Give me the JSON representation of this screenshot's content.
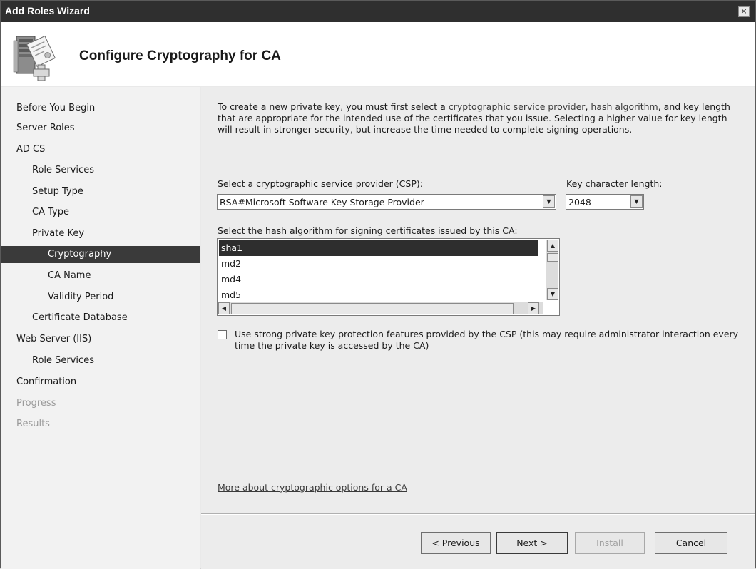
{
  "window": {
    "title": "Add Roles Wizard",
    "close_glyph": "×"
  },
  "header": {
    "title": "Configure Cryptography for CA",
    "icon": "server-certificate-icon"
  },
  "sidebar": {
    "items": [
      {
        "label": "Before You Begin"
      },
      {
        "label": "Server Roles"
      },
      {
        "label": "AD CS"
      },
      {
        "label": "Role Services"
      },
      {
        "label": "Setup Type"
      },
      {
        "label": "CA Type"
      },
      {
        "label": "Private Key"
      },
      {
        "label": "Cryptography"
      },
      {
        "label": "CA Name"
      },
      {
        "label": "Validity Period"
      },
      {
        "label": "Certificate Database"
      },
      {
        "label": "Web Server (IIS)"
      },
      {
        "label": "Role Services"
      },
      {
        "label": "Confirmation"
      },
      {
        "label": "Progress"
      },
      {
        "label": "Results"
      }
    ]
  },
  "description": {
    "part1": "To create a new private key, you must first select a ",
    "link1": "cryptographic service provider",
    "part2": ", ",
    "link2": "hash algorithm",
    "part3": ", and key length that are appropriate for the intended use of the certificates that you issue. Selecting a higher value for key length will result in stronger security, but increase the time needed to complete signing operations."
  },
  "csp": {
    "label": "Select a cryptographic service provider (CSP):",
    "value": "RSA#Microsoft Software Key Storage Provider"
  },
  "key_length": {
    "label": "Key character length:",
    "value": "2048"
  },
  "hash": {
    "label": "Select the hash algorithm for signing certificates issued by this CA:",
    "items": [
      "sha1",
      "md2",
      "md4",
      "md5"
    ],
    "selected": "sha1"
  },
  "strong_protection": {
    "label": "Use strong private key protection features provided by the CSP (this may require administrator interaction every time the private key is accessed by the CA)",
    "checked": false
  },
  "more_link": "More about cryptographic options for a CA",
  "buttons": {
    "previous": "< Previous",
    "next": "Next >",
    "install": "Install",
    "cancel": "Cancel"
  },
  "colors": {
    "titlebar": "#2f2f2f",
    "selection": "#2e2e2e",
    "window_bg": "#ececec"
  }
}
